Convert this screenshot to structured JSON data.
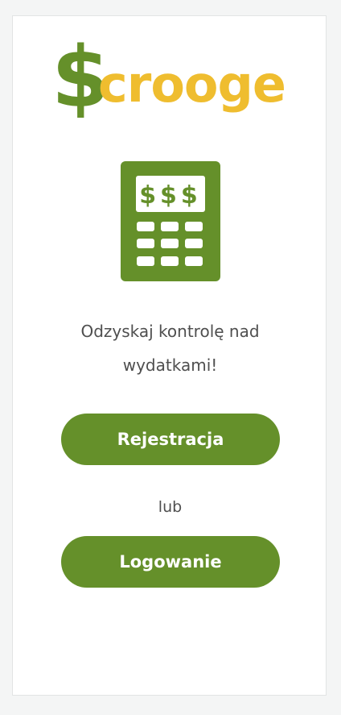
{
  "app": {
    "logo_dollar": "$",
    "logo_rest": "crooge"
  },
  "hero": {
    "calculator_icon": "calculator-icon",
    "display_text": "$$$",
    "tagline": "Odzyskaj kontrolę nad wydatkami!"
  },
  "actions": {
    "register_label": "Rejestracja",
    "or_label": "lub",
    "login_label": "Logowanie"
  },
  "colors": {
    "brand_green": "#65902a",
    "brand_yellow": "#efbd2f",
    "text_gray": "#4f4f4f"
  }
}
